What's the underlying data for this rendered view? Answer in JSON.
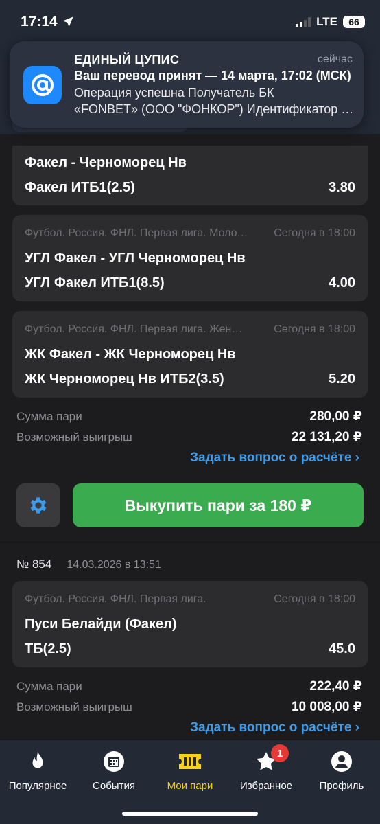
{
  "status_bar": {
    "time": "17:14",
    "network": "LTE",
    "battery": "66"
  },
  "notification": {
    "app": "ЕДИНЫЙ ЦУПИС",
    "time": "сейчас",
    "line1": "Ваш перевод принят — 14 марта, 17:02 (МСК)",
    "line2": "Операция успешна Получатель БК",
    "line3": "«FONBET» (ООО \"ФОНКОР\") Идентификатор операции"
  },
  "bets": [
    {
      "selections": [
        {
          "league": "",
          "time": "",
          "match": "Факел - Черноморец Нв",
          "market": "Факел ИТБ1(2.5)",
          "odds": "3.80"
        },
        {
          "league": "Футбол. Россия. ФНЛ. Первая лига. Молодёжные составы",
          "time": "Сегодня в 18:00",
          "match": "УГЛ Факел - УГЛ Черноморец Нв",
          "market": "УГЛ Факел ИТБ1(8.5)",
          "odds": "4.00"
        },
        {
          "league": "Футбол. Россия. ФНЛ. Первая лига. Женщины",
          "time": "Сегодня в 18:00",
          "match": "ЖК Факел - ЖК Черноморец Нв",
          "market": "ЖК Черноморец Нв ИТБ2(3.5)",
          "odds": "5.20"
        }
      ],
      "stake_label": "Сумма пари",
      "stake": "280,00 ₽",
      "win_label": "Возможный выигрыш",
      "win": "22 131,20 ₽",
      "ask_link": "Задать вопрос о расчёте ›",
      "buyout_label": "Выкупить пари за  180 ₽"
    },
    {
      "number": "№ 854",
      "date": "14.03.2026 в 13:51",
      "selections": [
        {
          "league": "Футбол. Россия. ФНЛ. Первая лига.",
          "time": "Сегодня в 18:00",
          "match": "Пуси Белайди (Факел)",
          "market": "ТБ(2.5)",
          "odds": "45.0"
        }
      ],
      "stake_label": "Сумма пари",
      "stake": "222,40 ₽",
      "win_label": "Возможный выигрыш",
      "win": "10 008,00 ₽",
      "ask_link": "Задать вопрос о расчёте ›"
    }
  ],
  "tabbar": {
    "items": [
      {
        "label": "Популярное",
        "icon": "flame-icon"
      },
      {
        "label": "События",
        "icon": "calendar-icon"
      },
      {
        "label": "Мои пари",
        "icon": "ticket-icon",
        "active": true
      },
      {
        "label": "Избранное",
        "icon": "star-icon",
        "badge": "1"
      },
      {
        "label": "Профиль",
        "icon": "profile-icon"
      }
    ]
  },
  "colors": {
    "background": "#1c1c1e",
    "card": "#2c2c2e",
    "accent_green": "#3bab4f",
    "link_blue": "#3d9be9",
    "active_tab": "#f7d217",
    "badge_red": "#e53935"
  }
}
